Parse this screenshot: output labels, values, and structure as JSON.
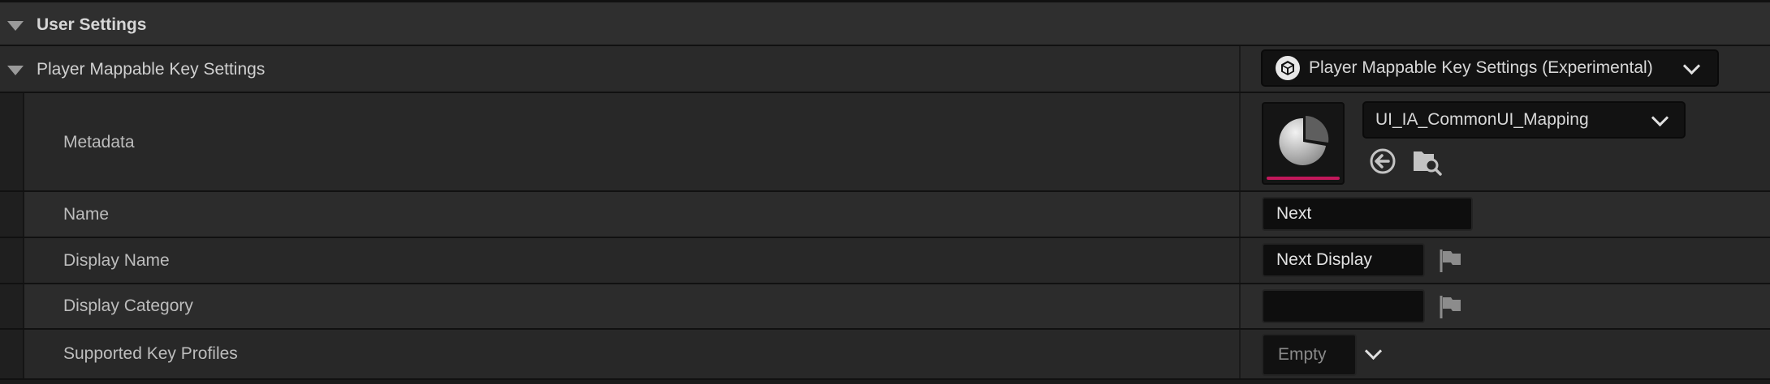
{
  "section": {
    "title": "User Settings"
  },
  "category": {
    "label": "Player Mappable Key Settings",
    "class_picker": {
      "value": "Player Mappable Key Settings (Experimental)",
      "icon": "cube-icon"
    }
  },
  "properties": {
    "metadata": {
      "label": "Metadata",
      "asset": {
        "value": "UI_IA_CommonUI_Mapping",
        "thumbnail_icon": "pie-asset-icon",
        "thumbnail_accent": "#c2185b"
      },
      "actions": [
        "use-selected-icon",
        "browse-asset-icon"
      ]
    },
    "name": {
      "label": "Name",
      "value": "Next"
    },
    "display_name": {
      "label": "Display Name",
      "value": "Next Display"
    },
    "display_category": {
      "label": "Display Category",
      "value": ""
    },
    "supported_key_profiles": {
      "label": "Supported Key Profiles",
      "value": "Empty"
    }
  },
  "colors": {
    "accent": "#c2185b",
    "panel": "#282828",
    "header": "#2f2f2f"
  }
}
